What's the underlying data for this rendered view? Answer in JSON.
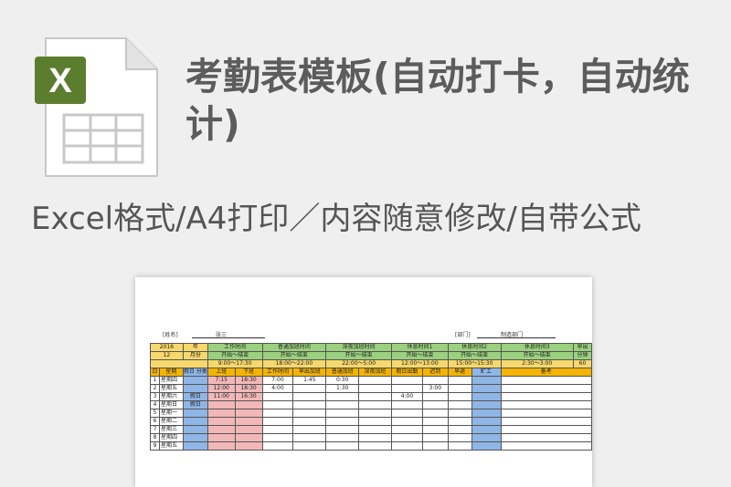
{
  "headline": "考勤表模板(自动打卡，自动统计)",
  "subtitle": "Excel格式/A4打印／内容随意修改/自带公式",
  "file_icon": {
    "letter": "X",
    "accent": "#5b7d2e"
  },
  "sheet": {
    "name_label": "[姓名]",
    "name_value": "张三",
    "dept_label": "[部门]",
    "dept_value": "制造部门",
    "year": "2016",
    "year_unit": "年",
    "month": "12",
    "month_unit": "月份",
    "right_label": "早出",
    "right_sub": "分钟",
    "right_value": "60",
    "groups": [
      {
        "title": "工作时间",
        "start": "9:00",
        "end": "17:30"
      },
      {
        "title": "普通加班时间",
        "start": "18:00",
        "end": "22:00"
      },
      {
        "title": "深夜加班时间",
        "start": "22:00",
        "end": "5:00"
      },
      {
        "title": "休息时间1",
        "start": "12:00",
        "end": "13:00"
      },
      {
        "title": "休息时间2",
        "start": "15:00",
        "end": "15:30"
      },
      {
        "title": "休息时间3",
        "start": "2:30",
        "end": "3:00"
      }
    ],
    "start_label": "开始",
    "sep": "～",
    "end_label": "结束",
    "headers": [
      "日",
      "星期",
      "假日\n分类",
      "上班",
      "下班",
      "工作时间",
      "早出加班",
      "普通加班",
      "深夜加班",
      "假日出勤",
      "迟到",
      "早退",
      "旷工",
      "备考"
    ],
    "rows": [
      {
        "day": "1",
        "week": "星期四",
        "hol": "",
        "in": "7:15",
        "out": "18:30",
        "work": "7:00",
        "early_ot": "1:45",
        "normal_ot": "0:30",
        "night_ot": "",
        "hol_work": "",
        "late": "",
        "leave": ""
      },
      {
        "day": "2",
        "week": "星期五",
        "hol": "",
        "in": "12:00",
        "out": "18:30",
        "work": "4:00",
        "early_ot": "",
        "normal_ot": "1:30",
        "night_ot": "",
        "hol_work": "",
        "late": "3:00",
        "leave": ""
      },
      {
        "day": "3",
        "week": "星期六",
        "hol": "假日",
        "in": "11:00",
        "out": "16:30",
        "work": "",
        "early_ot": "",
        "normal_ot": "",
        "night_ot": "",
        "hol_work": "4:00",
        "late": "",
        "leave": ""
      },
      {
        "day": "4",
        "week": "星期日",
        "hol": "假日",
        "in": "",
        "out": "",
        "work": "",
        "early_ot": "",
        "normal_ot": "",
        "night_ot": "",
        "hol_work": "",
        "late": "",
        "leave": ""
      },
      {
        "day": "5",
        "week": "星期一",
        "hol": "",
        "in": "",
        "out": "",
        "work": "",
        "early_ot": "",
        "normal_ot": "",
        "night_ot": "",
        "hol_work": "",
        "late": "",
        "leave": ""
      },
      {
        "day": "6",
        "week": "星期二",
        "hol": "",
        "in": "",
        "out": "",
        "work": "",
        "early_ot": "",
        "normal_ot": "",
        "night_ot": "",
        "hol_work": "",
        "late": "",
        "leave": ""
      },
      {
        "day": "7",
        "week": "星期三",
        "hol": "",
        "in": "",
        "out": "",
        "work": "",
        "early_ot": "",
        "normal_ot": "",
        "night_ot": "",
        "hol_work": "",
        "late": "",
        "leave": ""
      },
      {
        "day": "8",
        "week": "星期四",
        "hol": "",
        "in": "",
        "out": "",
        "work": "",
        "early_ot": "",
        "normal_ot": "",
        "night_ot": "",
        "hol_work": "",
        "late": "",
        "leave": ""
      },
      {
        "day": "9",
        "week": "星期五",
        "hol": "",
        "in": "",
        "out": "",
        "work": "",
        "early_ot": "",
        "normal_ot": "",
        "night_ot": "",
        "hol_work": "",
        "late": "",
        "leave": ""
      }
    ]
  }
}
